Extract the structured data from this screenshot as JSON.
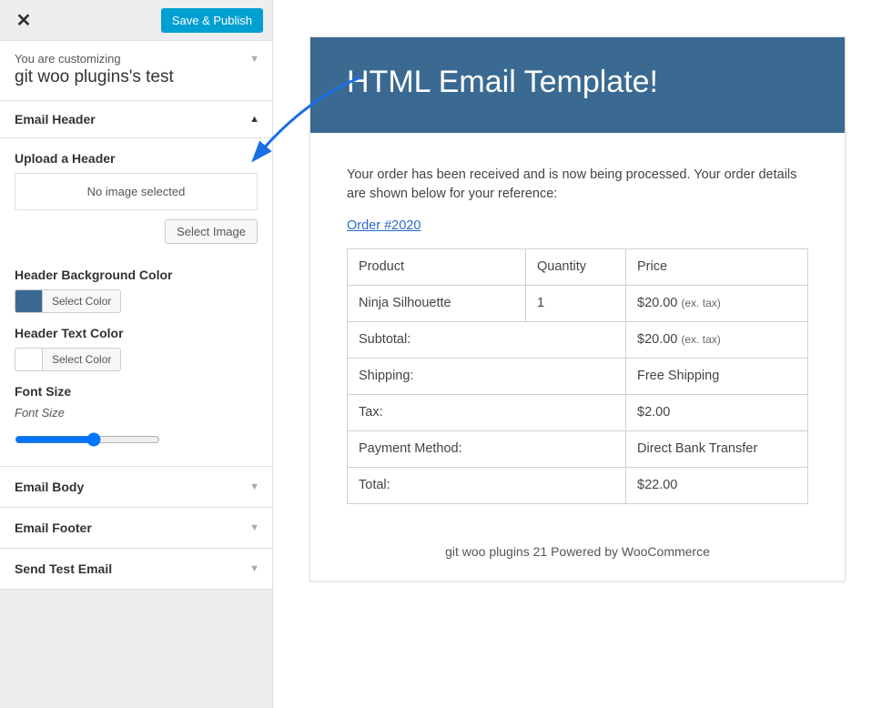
{
  "actions": {
    "save": "Save & Publish"
  },
  "info": {
    "sub": "You are customizing",
    "title": "git woo plugins's test"
  },
  "sections": {
    "header": {
      "title": "Email Header"
    },
    "body": {
      "title": "Email Body"
    },
    "footer": {
      "title": "Email Footer"
    },
    "test": {
      "title": "Send Test Email"
    }
  },
  "upload": {
    "label": "Upload a Header",
    "placeholder": "No image selected",
    "button": "Select Image"
  },
  "bgcolor": {
    "label": "Header Background Color",
    "button": "Select Color",
    "value": "#3a6a92"
  },
  "textcolor": {
    "label": "Header Text Color",
    "button": "Select Color",
    "value": "#ffffff"
  },
  "fontsize": {
    "label": "Font Size",
    "sublabel": "Font Size"
  },
  "email": {
    "title": "HTML Email Template!",
    "intro": "Your order has been received and is now being processed. Your order details are shown below for your reference:",
    "order_link": "Order #2020",
    "headers": {
      "product": "Product",
      "qty": "Quantity",
      "price": "Price"
    },
    "item": {
      "name": "Ninja Silhouette",
      "qty": "1",
      "price": "$20.00",
      "tax_note": "(ex. tax)"
    },
    "rows": {
      "subtotal_label": "Subtotal:",
      "subtotal_val": "$20.00",
      "subtotal_note": "(ex. tax)",
      "shipping_label": "Shipping:",
      "shipping_val": "Free Shipping",
      "tax_label": "Tax:",
      "tax_val": "$2.00",
      "payment_label": "Payment Method:",
      "payment_val": "Direct Bank Transfer",
      "total_label": "Total:",
      "total_val": "$22.00"
    },
    "footer": "git woo plugins 21 Powered by WooCommerce"
  }
}
